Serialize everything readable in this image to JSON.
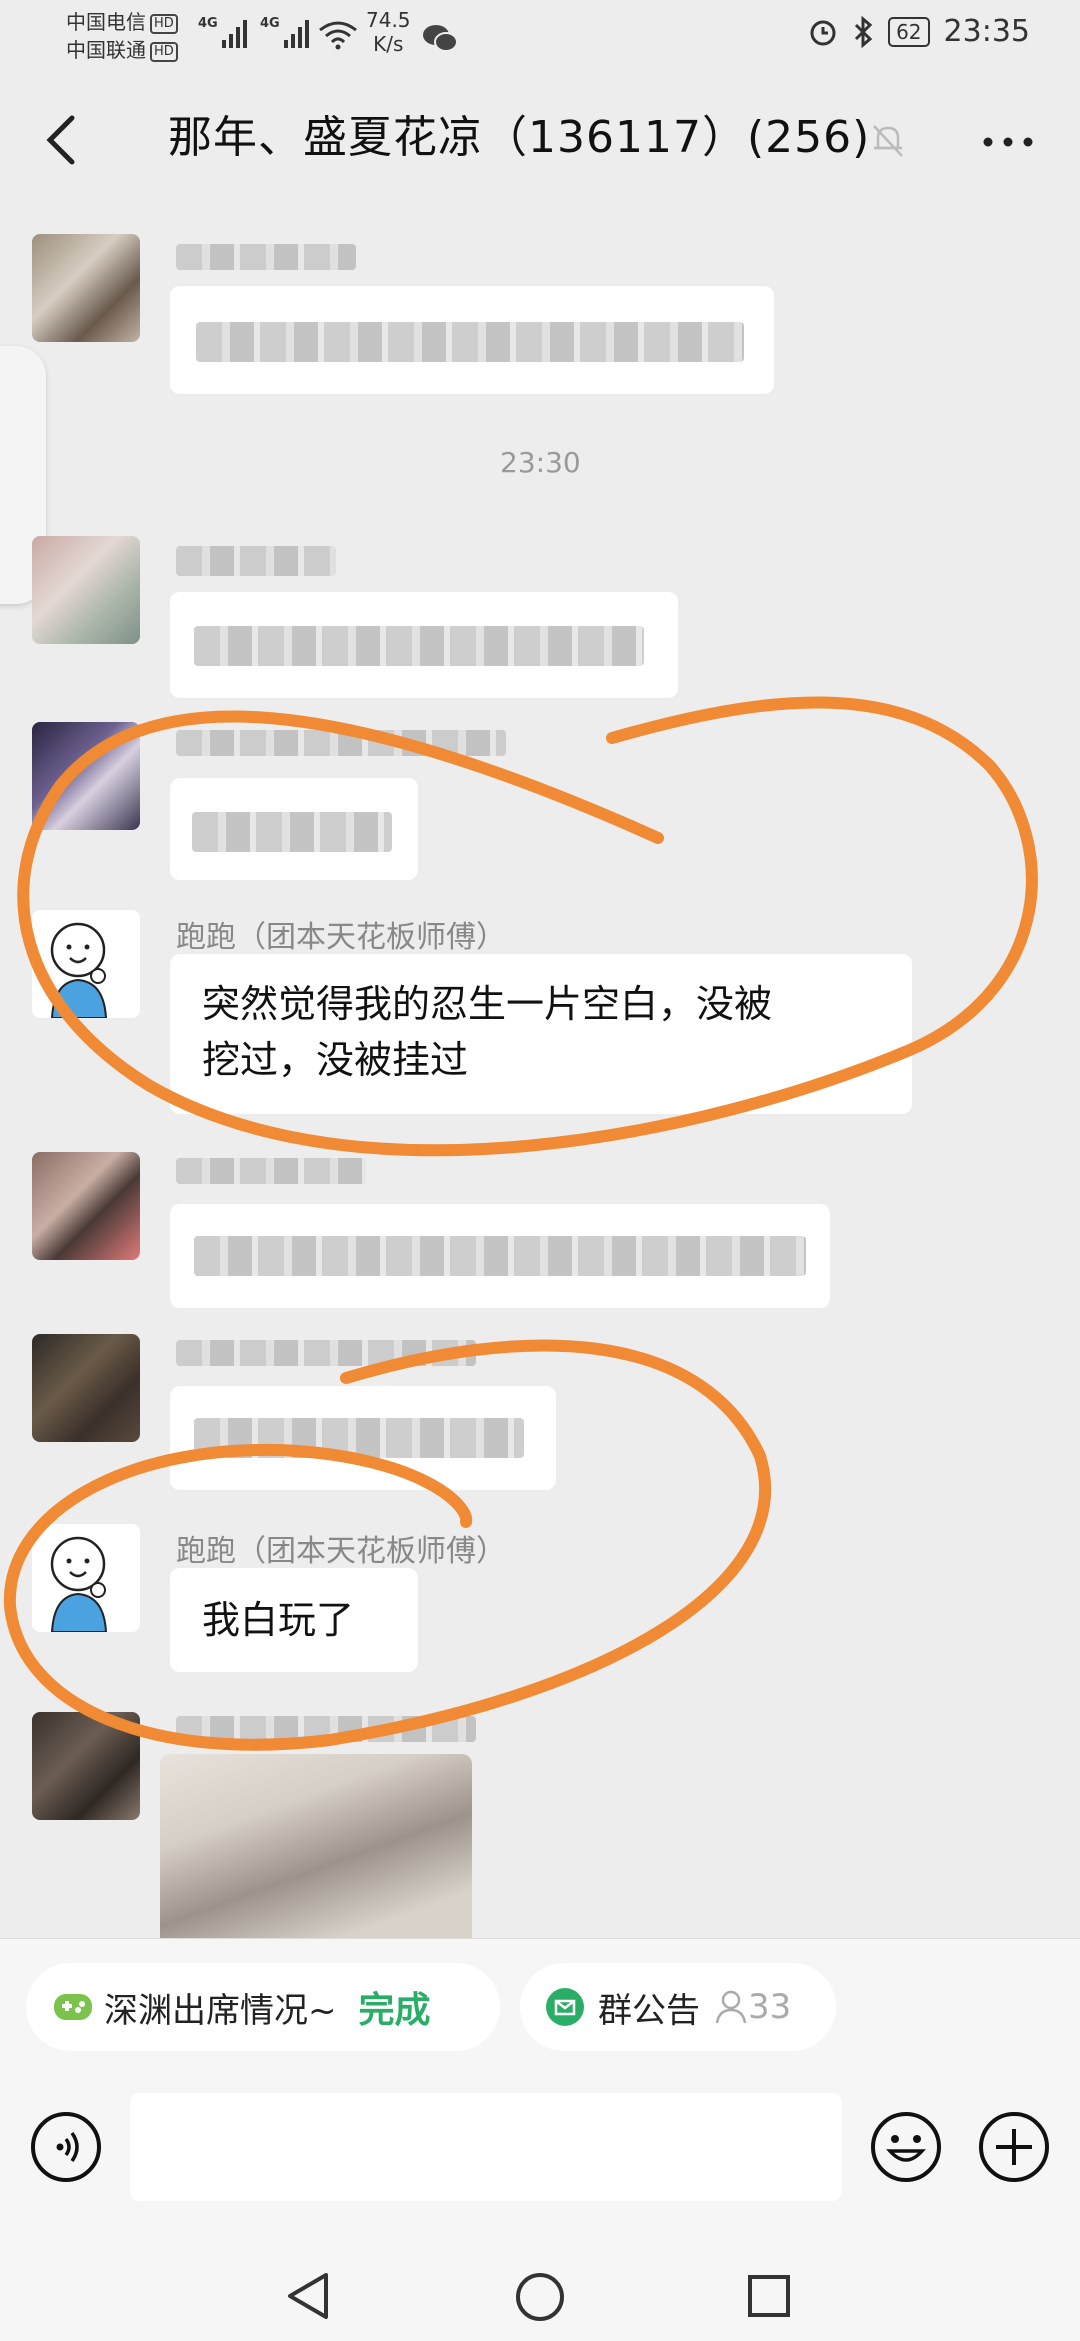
{
  "status": {
    "carrier1": "中国电信",
    "carrier2": "中国联通",
    "hd": "HD",
    "net1": "4G",
    "net2": "4G",
    "speed_value": "74.5",
    "speed_unit": "K/s",
    "battery": "62",
    "time": "23:35"
  },
  "header": {
    "title": "那年、盛夏花凉（136117）(256)"
  },
  "chat": {
    "timestamp": "23:30",
    "messages": [
      {
        "sender": "跑跑（团本天花板师傅）",
        "line1": "突然觉得我的忍生一片空白，没被",
        "line2": "挖过，没被挂过"
      },
      {
        "sender": "跑跑（团本天花板师傅）",
        "line1": "我白玩了"
      }
    ]
  },
  "bottom": {
    "shortcut1_label": "深渊出席情况~",
    "shortcut1_status": "完成",
    "shortcut2_label": "群公告",
    "shortcut2_count": "33"
  },
  "colors": {
    "annotation": "#f08a35",
    "accent_green": "#2aae67"
  },
  "icons": [
    "back-icon",
    "mute-bell-icon",
    "more-icon",
    "voice-icon",
    "emoji-icon",
    "plus-icon",
    "game-icon",
    "announcement-icon",
    "person-icon",
    "nav-back-icon",
    "nav-home-icon",
    "nav-recents-icon",
    "alarm-icon",
    "bluetooth-icon",
    "wifi-icon",
    "wechat-icon"
  ]
}
